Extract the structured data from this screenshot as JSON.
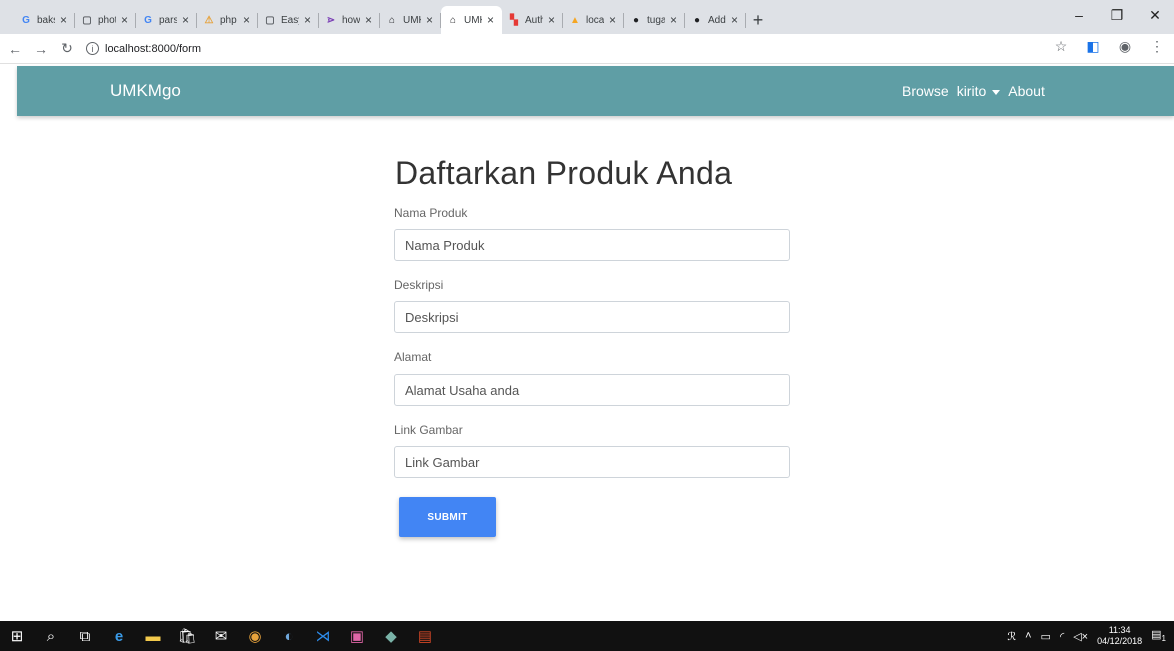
{
  "browser": {
    "tabs": [
      {
        "title": "bakso",
        "favicon": "G",
        "favicon_color": "#4285f4"
      },
      {
        "title": "photo",
        "favicon": "▢",
        "favicon_color": "#5f6368"
      },
      {
        "title": "parsin",
        "favicon": "G",
        "favicon_color": "#4285f4"
      },
      {
        "title": "php -",
        "favicon": "⚠",
        "favicon_color": "#e6a23c"
      },
      {
        "title": "Easy",
        "favicon": "▢",
        "favicon_color": "#5f6368"
      },
      {
        "title": "how t",
        "favicon": "⋗",
        "favicon_color": "#7b3fb5"
      },
      {
        "title": "UMKI",
        "favicon": "⌂",
        "favicon_color": "#202124"
      },
      {
        "title": "UMKI",
        "favicon": "⌂",
        "favicon_color": "#202124"
      },
      {
        "title": "Authe",
        "favicon": "▚",
        "favicon_color": "#e53935"
      },
      {
        "title": "localh",
        "favicon": "▲",
        "favicon_color": "#f5a623"
      },
      {
        "title": "tugas",
        "favicon": "●",
        "favicon_color": "#202124"
      },
      {
        "title": "Addin",
        "favicon": "●",
        "favicon_color": "#202124"
      }
    ],
    "active_tab_index": 7,
    "new_tab_label": "+",
    "url": "localhost:8000/form"
  },
  "app": {
    "brand": "UMKMgo",
    "nav": {
      "browse": "Browse",
      "user": "kirito",
      "about": "About"
    },
    "navbar_color": "#5f9ea5"
  },
  "form": {
    "title": "Daftarkan Produk Anda",
    "fields": [
      {
        "label": "Nama Produk",
        "placeholder": "Nama Produk"
      },
      {
        "label": "Deskripsi",
        "placeholder": "Deskripsi"
      },
      {
        "label": "Alamat",
        "placeholder": "Alamat Usaha anda"
      },
      {
        "label": "Link Gambar",
        "placeholder": "Link Gambar"
      }
    ],
    "submit_label": "SUBMIT",
    "submit_color": "#4285f4"
  },
  "taskbar": {
    "time": "11:34",
    "date": "04/12/2018",
    "notification_count": "1"
  }
}
